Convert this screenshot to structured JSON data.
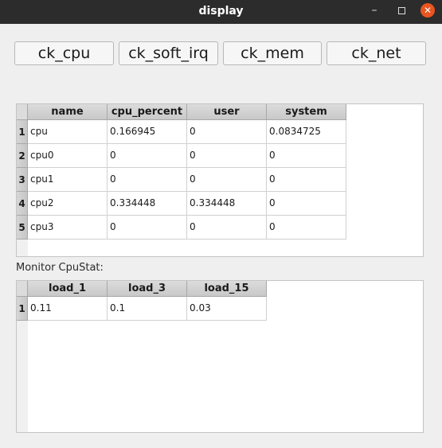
{
  "window": {
    "title": "display"
  },
  "buttons": [
    "ck_cpu",
    "ck_soft_irq",
    "ck_mem",
    "ck_net"
  ],
  "cpu_table": {
    "headers": [
      "name",
      "cpu_percent",
      "user",
      "system"
    ],
    "row_numbers": [
      "1",
      "2",
      "3",
      "4",
      "5"
    ],
    "rows": [
      [
        "cpu",
        "0.166945",
        "0",
        "0.0834725"
      ],
      [
        "cpu0",
        "0",
        "0",
        "0"
      ],
      [
        "cpu1",
        "0",
        "0",
        "0"
      ],
      [
        "cpu2",
        "0.334448",
        "0.334448",
        "0"
      ],
      [
        "cpu3",
        "0",
        "0",
        "0"
      ]
    ]
  },
  "monitor_label": "Monitor CpuStat:",
  "load_table": {
    "headers": [
      "load_1",
      "load_3",
      "load_15"
    ],
    "row_numbers": [
      "1"
    ],
    "rows": [
      [
        "0.11",
        "0.1",
        "0.03"
      ]
    ]
  }
}
